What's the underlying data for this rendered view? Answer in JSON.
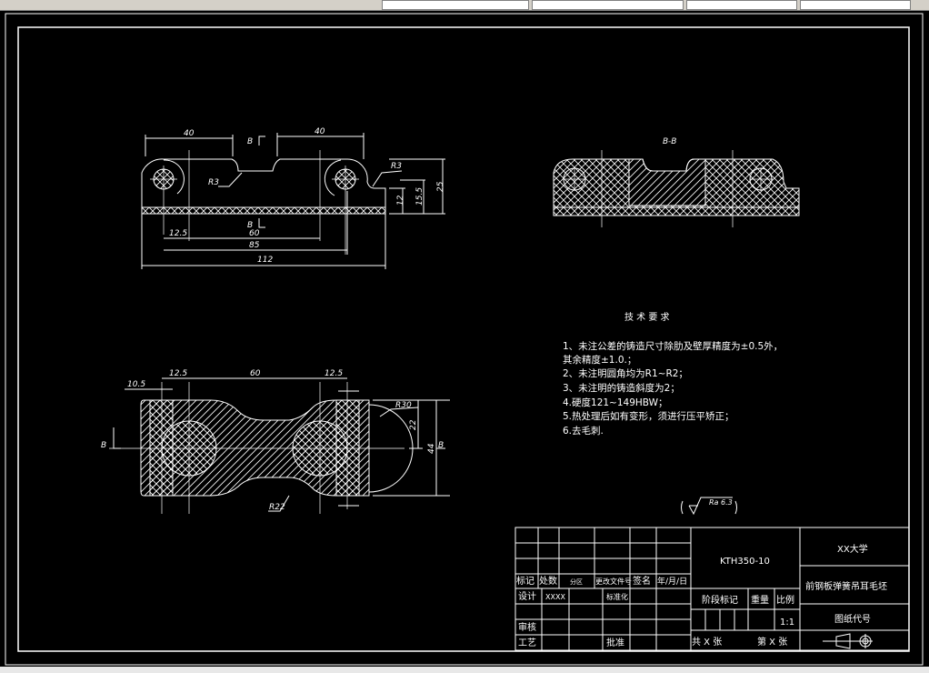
{
  "window": {
    "canvas_background": "#000000",
    "line_color": "#ffffff"
  },
  "front_view": {
    "dims": [
      "40",
      "40",
      "R3",
      "R3",
      "12.5",
      "60",
      "85",
      "112",
      "12",
      "15.5",
      "25"
    ],
    "section_mark": "B"
  },
  "section_view": {
    "title": "B-B"
  },
  "top_view": {
    "dims": [
      "10.5",
      "12.5",
      "60",
      "12.5",
      "R30",
      "22",
      "44",
      "R22"
    ],
    "section_mark": "B"
  },
  "tech_requirements": {
    "title": "技 术 要 求",
    "lines": [
      "1、未注公差的铸造尺寸除肋及壁厚精度为±0.5外，",
      "其余精度±1.0.；",
      "2、未注明圆角均为R1~R2；",
      "3、未注明的铸造斜度为2；",
      "4.硬度121~149HBW；",
      "5.热处理后如有变形，须进行压平矫正；",
      "6.去毛刺."
    ]
  },
  "roughness": {
    "label": "Ra 6.3"
  },
  "title_block": {
    "drawing_number": "KTH350-10",
    "school": "XX大学",
    "part_name": "前钢板弹簧吊耳毛坯",
    "drawing_code_label": "图纸代号",
    "revision_headers": [
      "标记",
      "处数",
      "分区",
      "更改文件号",
      "签名",
      "年/月/日"
    ],
    "design_label": "设计",
    "designer": "XXXX",
    "standardization_label": "标准化",
    "review_label": "审核",
    "process_label": "工艺",
    "approve_label": "批准",
    "stage_label": "阶段标记",
    "weight_label": "重量",
    "scale_label": "比例",
    "scale_value": "1:1",
    "total_sheets": "共 X 张",
    "sheet_no": "第 X 张"
  }
}
